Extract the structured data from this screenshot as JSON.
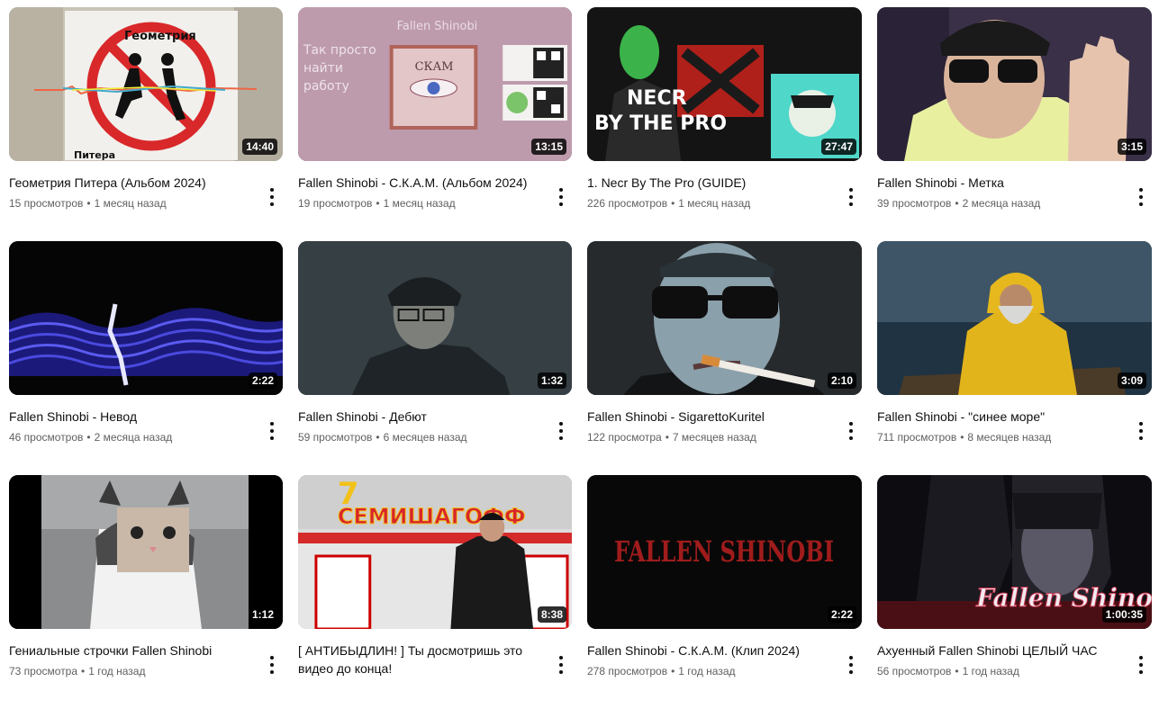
{
  "videos": [
    {
      "title": "Геометрия Питера (Альбом 2024)",
      "views": "15 просмотров",
      "age": "1 месяц назад",
      "duration": "14:40",
      "thumb_texts": [
        "Геометрия",
        "Питера"
      ]
    },
    {
      "title": "Fallen Shinobi - С.К.А.М. (Альбом 2024)",
      "views": "19 просмотров",
      "age": "1 месяц назад",
      "duration": "13:15",
      "thumb_texts": [
        "Fallen Shinobi",
        "Так просто",
        "найти",
        "работу",
        "СКАМ"
      ]
    },
    {
      "title": "1. Necr By The Pro (GUIDE)",
      "views": "226 просмотров",
      "age": "1 месяц назад",
      "duration": "27:47",
      "thumb_texts": [
        "NECR",
        "BY THE PRO"
      ]
    },
    {
      "title": "Fallen Shinobi - Метка",
      "views": "39 просмотров",
      "age": "2 месяца назад",
      "duration": "3:15",
      "thumb_texts": []
    },
    {
      "title": "Fallen Shinobi - Невод",
      "views": "46 просмотров",
      "age": "2 месяца назад",
      "duration": "2:22",
      "thumb_texts": []
    },
    {
      "title": "Fallen Shinobi - Дебют",
      "views": "59 просмотров",
      "age": "6 месяцев назад",
      "duration": "1:32",
      "thumb_texts": []
    },
    {
      "title": "Fallen Shinobi - SigarettoKuritel",
      "views": "122 просмотра",
      "age": "7 месяцев назад",
      "duration": "2:10",
      "thumb_texts": []
    },
    {
      "title": "Fallen Shinobi - \"синее море\"",
      "views": "711 просмотров",
      "age": "8 месяцев назад",
      "duration": "3:09",
      "thumb_texts": []
    },
    {
      "title": "Гениальные строчки Fallen Shinobi",
      "views": "73 просмотра",
      "age": "1 год назад",
      "duration": "1:12",
      "thumb_texts": []
    },
    {
      "title": "[ АНТИБЫДЛИН! ] Ты досмотришь это видео до концa!",
      "views": "",
      "age": "",
      "duration": "8:38",
      "thumb_texts": [
        "СЕМИШАГОФФ",
        "7"
      ]
    },
    {
      "title": "Fallen Shinobi - С.К.А.М. (Клип 2024)",
      "views": "278 просмотров",
      "age": "1 год назад",
      "duration": "2:22",
      "thumb_texts": [
        "FALLEN SHINOBI"
      ]
    },
    {
      "title": "Ахуенный Fallen Shinobi ЦЕЛЫЙ ЧАС",
      "views": "56 просмотров",
      "age": "1 год назад",
      "duration": "1:00:35",
      "thumb_texts": [
        "Fallen Shinobi"
      ]
    }
  ],
  "separator": "•",
  "menu_icon": "more-vert-icon"
}
